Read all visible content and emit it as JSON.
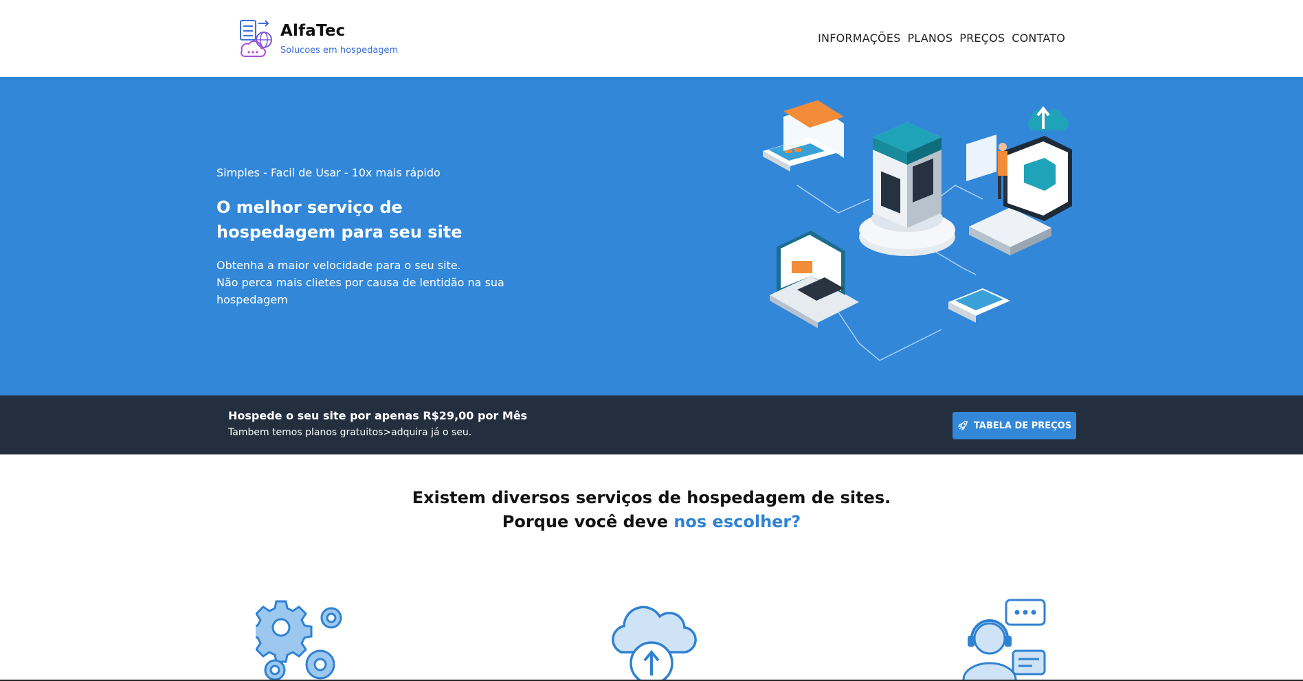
{
  "header": {
    "brand": "AlfaTec",
    "tagline": "Solucoes em hospedagem",
    "nav": [
      {
        "label": "INFORMAÇÕES"
      },
      {
        "label": "PLANOS"
      },
      {
        "label": "PREÇOS"
      },
      {
        "label": "CONTATO"
      }
    ]
  },
  "hero": {
    "tagline": "Simples - Facil de Usar - 10x mais rápido",
    "title": "O melhor serviço de hospedagem para seu site",
    "description_line1": "Obtenha a maior velocidade para o seu site.",
    "description_line2": "Não perca mais clietes por causa de lentidão na sua hospedagem"
  },
  "banner": {
    "main": "Hospede o seu site por apenas R$29,00 por Mês",
    "sub": "Tambem temos planos gratuitos>adquira já o seu.",
    "button_label": "TABELA DE PREÇOS"
  },
  "why": {
    "line1": "Existem diversos serviços de hospedagem de sites.",
    "line2_prefix": "Porque você deve ",
    "line2_highlight": "nos escolher?"
  },
  "features": [
    {
      "icon": "gears-icon"
    },
    {
      "icon": "cloud-upload-icon"
    },
    {
      "icon": "support-agent-icon"
    }
  ],
  "colors": {
    "accent": "#3287d9",
    "banner": "#232f3e",
    "highlight": "#2f82d2"
  }
}
